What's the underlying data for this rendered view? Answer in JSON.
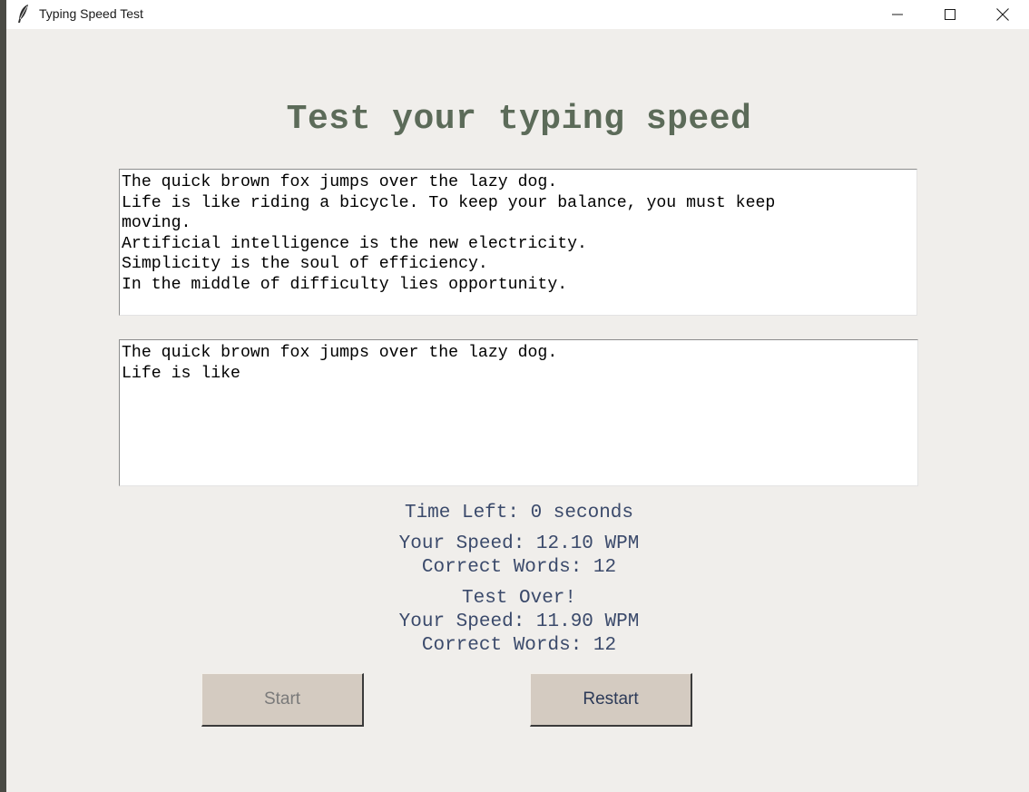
{
  "window": {
    "title": "Typing Speed Test",
    "icon": "feather-icon"
  },
  "heading": "Test your typing speed",
  "sample_text": "The quick brown fox jumps over the lazy dog.\nLife is like riding a bicycle. To keep your balance, you must keep\nmoving.\nArtificial intelligence is the new electricity.\nSimplicity is the soul of efficiency.\nIn the middle of difficulty lies opportunity.",
  "typed_text": "The quick brown fox jumps over the lazy dog.\nLife is like",
  "stats": {
    "time_left": "Time Left: 0 seconds",
    "speed": "Your Speed: 12.10 WPM",
    "correct_words": "Correct Words: 12",
    "test_over": "Test Over!",
    "final_speed": "Your Speed: 11.90 WPM",
    "final_correct_words": "Correct Words: 12"
  },
  "buttons": {
    "start_label": "Start",
    "restart_label": "Restart"
  },
  "colors": {
    "heading": "#5c6b59",
    "stats_text": "#3b4a6b",
    "button_bg": "#d4cbc1",
    "window_bg": "#f0eeeb"
  }
}
